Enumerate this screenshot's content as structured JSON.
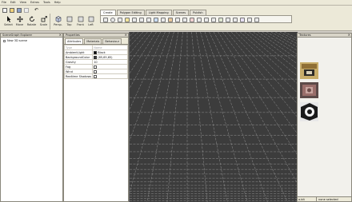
{
  "menu": [
    "File",
    "Edit",
    "View",
    "Extras",
    "Tools",
    "Help"
  ],
  "tools": {
    "select": "Select",
    "move": "Move",
    "rotate": "Rotate",
    "scale": "Scale",
    "persp": "Persp.",
    "top": "Top",
    "front": "Front",
    "left": "Left"
  },
  "mode_tabs": [
    "Create",
    "Polygon Editing",
    "Light Mapping",
    "Scenes",
    "Publish"
  ],
  "active_mode_tab": 0,
  "scene_graph": {
    "title": "SceneGraph Explorer",
    "root": "New 3D scene"
  },
  "properties": {
    "title": "Properties",
    "tabs": [
      "Attributes",
      "Materials",
      "Behaviour"
    ],
    "header": [
      "Type",
      "Name"
    ],
    "rows": [
      {
        "key": "AmbientLight",
        "value": "Black",
        "swatch": "#000000"
      },
      {
        "key": "BackgroundColor",
        "value": "(65,65,65)",
        "swatch": "#414141"
      },
      {
        "key": "Gravity",
        "value": "10"
      },
      {
        "key": "Fog",
        "checkbox": true
      },
      {
        "key": "Wind",
        "checkbox": true
      },
      {
        "key": "Realtime Shadows",
        "checkbox": true
      }
    ]
  },
  "textures": {
    "title": "Textures",
    "status_left": "a.bit",
    "status_right": "none selected"
  },
  "colors": {
    "viewport_bg": "#3c3c3c",
    "grid_line": "#9a9a9a",
    "chrome": "#d4d0c8"
  }
}
